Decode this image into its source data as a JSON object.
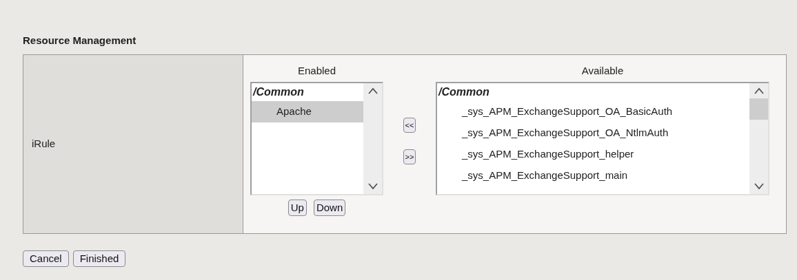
{
  "section_title": "Resource Management",
  "field": {
    "label": "iRule",
    "enabled": {
      "heading": "Enabled",
      "items": [
        {
          "kind": "group",
          "text": "/Common",
          "selected": false
        },
        {
          "kind": "item",
          "text": "Apache",
          "selected": true
        }
      ]
    },
    "move_buttons": [
      "<<",
      ">>"
    ],
    "order_buttons": [
      "Up",
      "Down"
    ],
    "available": {
      "heading": "Available",
      "items": [
        {
          "kind": "group",
          "text": "/Common",
          "selected": false
        },
        {
          "kind": "item",
          "text": "_sys_APM_ExchangeSupport_OA_BasicAuth",
          "selected": false
        },
        {
          "kind": "item",
          "text": "_sys_APM_ExchangeSupport_OA_NtlmAuth",
          "selected": false
        },
        {
          "kind": "item",
          "text": "_sys_APM_ExchangeSupport_helper",
          "selected": false
        },
        {
          "kind": "item",
          "text": "_sys_APM_ExchangeSupport_main",
          "selected": false
        }
      ]
    }
  },
  "buttons": [
    "Cancel",
    "Finished"
  ]
}
